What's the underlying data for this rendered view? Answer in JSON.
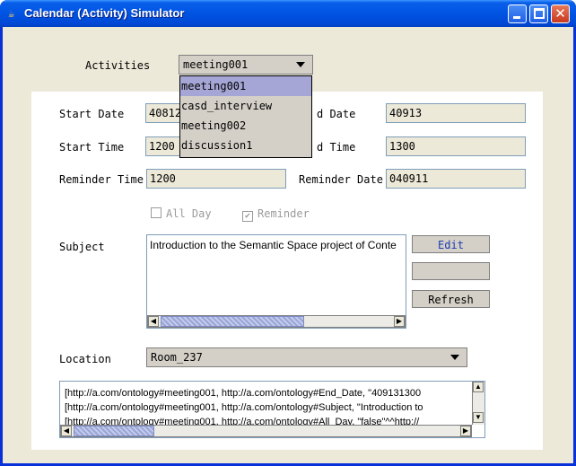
{
  "window": {
    "title": "Calendar (Activity) Simulator",
    "title_icon": "java-cup-icon"
  },
  "activities": {
    "label": "Activities",
    "selected": "meeting001",
    "options": [
      "meeting001",
      "casd_interview",
      "meeting002",
      "discussion1"
    ]
  },
  "fields": {
    "start_date_label": "Start Date",
    "start_date": "40812",
    "end_date_label": "d Date",
    "end_date": "40913",
    "start_time_label": "Start Time",
    "start_time": "1200",
    "end_time_label": "d Time",
    "end_time": "1300",
    "reminder_time_label": "Reminder Time",
    "reminder_time": "1200",
    "reminder_date_label": "Reminder Date",
    "reminder_date": "040911"
  },
  "checks": {
    "all_day_label": "All Day",
    "all_day_checked": false,
    "reminder_label": "Reminder",
    "reminder_checked": true
  },
  "subject": {
    "label": "Subject",
    "text": "Introduction to the Semantic Space project of Conte"
  },
  "buttons": {
    "edit": "Edit",
    "blank": "",
    "refresh": "Refresh"
  },
  "location": {
    "label": "Location",
    "selected": "Room_237"
  },
  "log": {
    "lines": [
      "[http://a.com/ontology#meeting001, http://a.com/ontology#End_Date, \"409131300",
      "[http://a.com/ontology#meeting001, http://a.com/ontology#Subject, \"Introduction to",
      "[http://a.com/ontology#meeting001, http://a.com/ontology#All_Day, \"false\"^^http://"
    ]
  },
  "colors": {
    "titlebar": "#0054e3",
    "frame": "#ece9d8",
    "selection": "#a6a6d6"
  }
}
